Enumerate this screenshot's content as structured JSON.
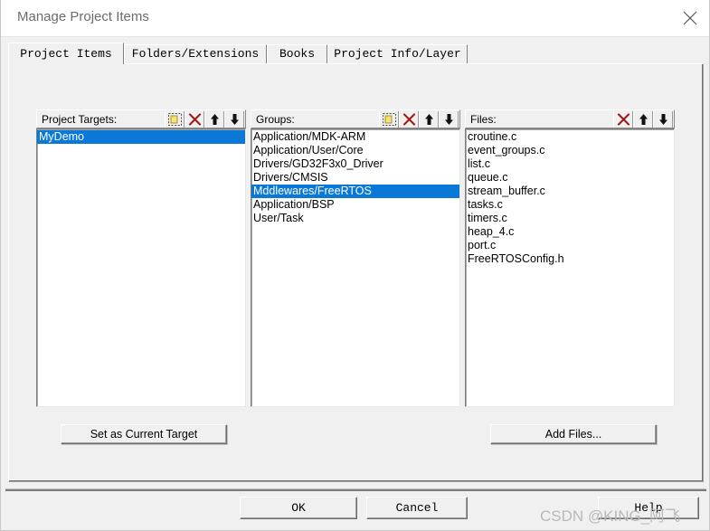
{
  "window": {
    "title": "Manage Project Items",
    "close_icon": "close-icon"
  },
  "tabs": [
    {
      "label": "Project Items",
      "active": true
    },
    {
      "label": "Folders/Extensions",
      "active": false
    },
    {
      "label": "Books",
      "active": false
    },
    {
      "label": "Project Info/Layer",
      "active": false
    }
  ],
  "panels": {
    "targets": {
      "header": "Project Targets:",
      "icons": [
        "new-item-icon",
        "delete-icon",
        "move-up-icon",
        "move-down-icon"
      ],
      "items": [
        "MyDemo"
      ],
      "selected_index": 0
    },
    "groups": {
      "header": "Groups:",
      "icons": [
        "new-item-icon",
        "delete-icon",
        "move-up-icon",
        "move-down-icon"
      ],
      "items": [
        "Application/MDK-ARM",
        "Application/User/Core",
        "Drivers/GD32F3x0_Driver",
        "Drivers/CMSIS",
        "Mddlewares/FreeRTOS",
        "Application/BSP",
        "User/Task"
      ],
      "selected_index": 4
    },
    "files": {
      "header": "Files:",
      "icons": [
        "delete-icon",
        "move-up-icon",
        "move-down-icon"
      ],
      "items": [
        "croutine.c",
        "event_groups.c",
        "list.c",
        "queue.c",
        "stream_buffer.c",
        "tasks.c",
        "timers.c",
        "heap_4.c",
        "port.c",
        "FreeRTOSConfig.h"
      ],
      "selected_index": -1
    }
  },
  "buttons": {
    "set_as_current_target": "Set as Current Target",
    "add_files": "Add Files...",
    "ok": "OK",
    "cancel": "Cancel",
    "help": "Help"
  },
  "watermark": {
    "text": "CSDN @KING_阿飞"
  },
  "colors": {
    "selection_blue": "#0a78d7",
    "dialog_face": "#f0f0f0",
    "delete_red": "#9e1b1b",
    "title_text": "#6b6b6b"
  }
}
